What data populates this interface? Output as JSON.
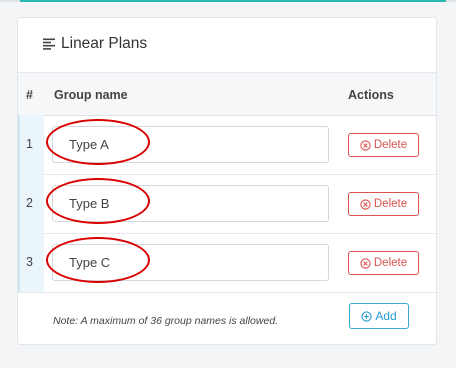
{
  "card": {
    "title": "Linear Plans",
    "title_icon": "list-align-left-icon"
  },
  "table": {
    "headers": {
      "num": "#",
      "group_name": "Group name",
      "actions": "Actions"
    },
    "rows": [
      {
        "num": "1",
        "name": "Type A",
        "delete_label": "Delete"
      },
      {
        "num": "2",
        "name": "Type B",
        "delete_label": "Delete"
      },
      {
        "num": "3",
        "name": "Type C",
        "delete_label": "Delete"
      }
    ]
  },
  "footer": {
    "note": "Note: A maximum of 36 group names is allowed.",
    "add_label": "Add"
  },
  "colors": {
    "delete": "#d9534f",
    "add": "#2a9bd0",
    "annotation": "#d90000",
    "accent": "#27b8b0"
  },
  "icons": {
    "delete": "circle-x-icon",
    "add": "circle-plus-icon"
  }
}
